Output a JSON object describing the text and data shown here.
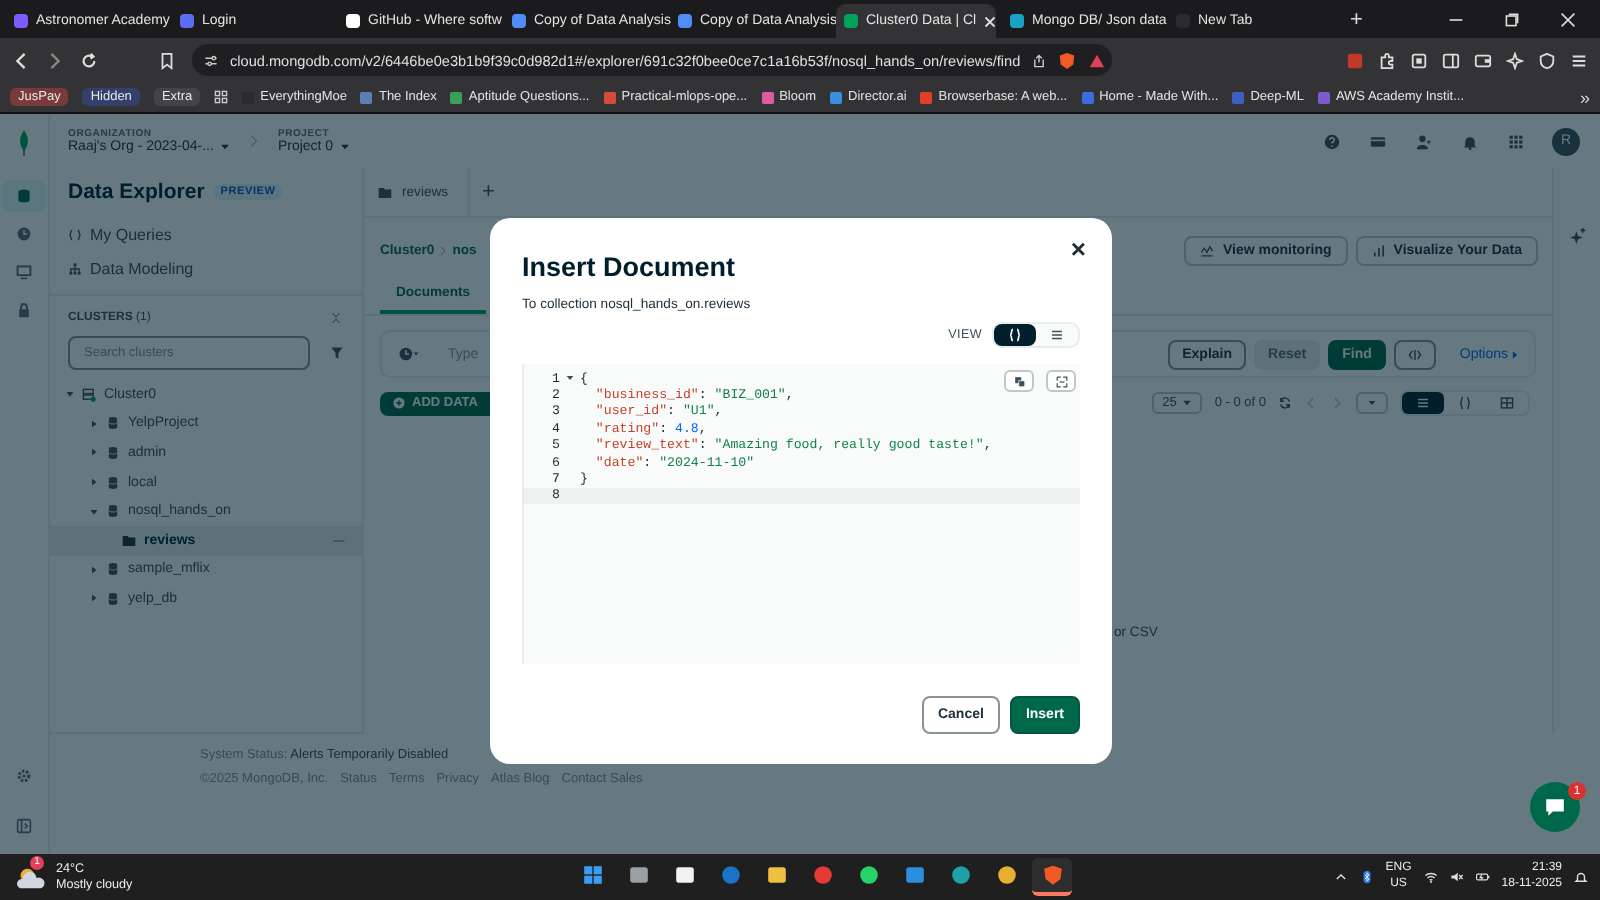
{
  "browser": {
    "tabs": [
      {
        "label": "Astronomer Academy",
        "color": "#7b5cff",
        "selected": false
      },
      {
        "label": "Login",
        "color": "#5b6cf0",
        "selected": false
      },
      {
        "label": "GitHub - Where softw",
        "color": "#ffffff",
        "selected": false
      },
      {
        "label": "Copy of Data Analysis",
        "color": "#4f8cf7",
        "selected": false
      },
      {
        "label": "Copy of Data Analysis",
        "color": "#4f8cf7",
        "selected": false
      },
      {
        "label": "Cluster0 Data | Cl",
        "color": "#00a35c",
        "selected": true
      },
      {
        "label": "Mongo DB/ Json data",
        "color": "#1ba3c6",
        "selected": false
      },
      {
        "label": "New Tab",
        "color": "#2b2b2d",
        "selected": false
      }
    ],
    "new_tab": "+",
    "url": "cloud.mongodb.com/v2/6446be0e3b1b9f39c0d982d1#/explorer/691c32f0bee0ce7c1a16b53f/nosql_hands_on/reviews/find",
    "bookmark_tags": [
      {
        "label": "JusPay",
        "color": "#7a3a3a"
      },
      {
        "label": "Hidden",
        "color": "#33406b"
      },
      {
        "label": "Extra",
        "color": "#444448"
      }
    ],
    "bookmarks": [
      {
        "label": "EverythingMoe",
        "color": "#2b2b2d"
      },
      {
        "label": "The Index",
        "color": "#5b7fb5"
      },
      {
        "label": "Aptitude Questions...",
        "color": "#3aa05a"
      },
      {
        "label": "Practical-mlops-ope...",
        "color": "#d84a3a"
      },
      {
        "label": "Bloom",
        "color": "#e05aa0"
      },
      {
        "label": "Director.ai",
        "color": "#3a8ee0"
      },
      {
        "label": "Browserbase: A web...",
        "color": "#e0402a"
      },
      {
        "label": "Home - Made With...",
        "color": "#3a6ee0"
      },
      {
        "label": "Deep-ML",
        "color": "#4060c0"
      },
      {
        "label": "AWS Academy Instit...",
        "color": "#7a5cd0"
      }
    ],
    "more": "»"
  },
  "rail": [
    {
      "kind": "database",
      "selected": true
    },
    {
      "kind": "clock",
      "selected": false
    },
    {
      "kind": "monitor",
      "selected": false
    },
    {
      "kind": "lock",
      "selected": false
    }
  ],
  "header": {
    "org_label": "ORGANIZATION",
    "org": "Raaj's Org - 2023-04-...",
    "project_label": "PROJECT",
    "project": "Project 0",
    "avatar": "R"
  },
  "sidebar": {
    "title": "Data Explorer",
    "badge": "PREVIEW",
    "links": [
      {
        "label": "My Queries",
        "kind": "queries"
      },
      {
        "label": "Data Modeling",
        "kind": "modeling"
      }
    ],
    "clusters_label": "CLUSTERS",
    "clusters_count": "(1)",
    "search_placeholder": "Search clusters",
    "tree": [
      {
        "label": "Cluster0",
        "kind": "cluster",
        "expanded": true,
        "children": [
          {
            "label": "YelpProject",
            "kind": "database",
            "expanded": false
          },
          {
            "label": "admin",
            "kind": "database",
            "expanded": false
          },
          {
            "label": "local",
            "kind": "database",
            "expanded": false
          },
          {
            "label": "nosql_hands_on",
            "kind": "database",
            "expanded": true,
            "children": [
              {
                "label": "reviews",
                "kind": "collection",
                "selected": true
              }
            ]
          },
          {
            "label": "sample_mflix",
            "kind": "database",
            "expanded": false
          },
          {
            "label": "yelp_db",
            "kind": "database",
            "expanded": false
          }
        ]
      }
    ]
  },
  "main": {
    "tab": "reviews",
    "add_tab": "+",
    "breadcrumb": [
      "Cluster0",
      "nos"
    ],
    "subtabs": [
      {
        "label": "Documents",
        "selected": true
      }
    ],
    "actions": [
      {
        "label": "View monitoring",
        "kind": "monitor"
      },
      {
        "label": "Visualize Your Data",
        "kind": "chart"
      }
    ],
    "filter_placeholder": "Type",
    "query_buttons": [
      {
        "label": "Explain",
        "kind": "default"
      },
      {
        "label": "Reset",
        "kind": "disabled"
      },
      {
        "label": "Find",
        "kind": "primary"
      }
    ],
    "options": "Options",
    "add_data": "ADD DATA",
    "page_size": "25",
    "range": "0 - 0 of 0",
    "views": [
      {
        "kind": "list",
        "selected": true
      },
      {
        "kind": "json",
        "selected": false
      },
      {
        "kind": "table",
        "selected": false
      }
    ],
    "empty_hint": "or CSV"
  },
  "footer": {
    "status_label": "System Status:",
    "status": "Alerts Temporarily Disabled",
    "links": [
      "©2025 MongoDB, Inc.",
      "Status",
      "Terms",
      "Privacy",
      "Atlas Blog",
      "Contact Sales"
    ]
  },
  "chat_badge": "1",
  "modal": {
    "title": "Insert Document",
    "subtitle": "To collection nosql_hands_on.reviews",
    "view_label": "VIEW",
    "views": [
      {
        "kind": "json",
        "selected": true
      },
      {
        "kind": "list",
        "selected": false
      }
    ],
    "lines": [
      {
        "num": "1",
        "fold": true,
        "active": false,
        "tokens": [
          {
            "kind": "punct",
            "text": "{"
          }
        ]
      },
      {
        "num": "2",
        "fold": false,
        "active": false,
        "tokens": [
          {
            "kind": "key",
            "text": "  \"business_id\""
          },
          {
            "kind": "punct",
            "text": ": "
          },
          {
            "kind": "string",
            "text": "\"BIZ_001\""
          },
          {
            "kind": "punct",
            "text": ","
          }
        ]
      },
      {
        "num": "3",
        "fold": false,
        "active": false,
        "tokens": [
          {
            "kind": "key",
            "text": "  \"user_id\""
          },
          {
            "kind": "punct",
            "text": ": "
          },
          {
            "kind": "string",
            "text": "\"U1\""
          },
          {
            "kind": "punct",
            "text": ","
          }
        ]
      },
      {
        "num": "4",
        "fold": false,
        "active": false,
        "tokens": [
          {
            "kind": "key",
            "text": "  \"rating\""
          },
          {
            "kind": "punct",
            "text": ": "
          },
          {
            "kind": "number",
            "text": "4.8"
          },
          {
            "kind": "punct",
            "text": ","
          }
        ]
      },
      {
        "num": "5",
        "fold": false,
        "active": false,
        "tokens": [
          {
            "kind": "key",
            "text": "  \"review_text\""
          },
          {
            "kind": "punct",
            "text": ": "
          },
          {
            "kind": "string",
            "text": "\"Amazing food, really good taste!\""
          },
          {
            "kind": "punct",
            "text": ","
          }
        ]
      },
      {
        "num": "6",
        "fold": false,
        "active": false,
        "tokens": [
          {
            "kind": "key",
            "text": "  \"date\""
          },
          {
            "kind": "punct",
            "text": ": "
          },
          {
            "kind": "string",
            "text": "\"2024-11-10\""
          }
        ]
      },
      {
        "num": "7",
        "fold": false,
        "active": false,
        "tokens": [
          {
            "kind": "punct",
            "text": "}"
          }
        ]
      },
      {
        "num": "8",
        "fold": false,
        "active": true
      }
    ],
    "close": "×",
    "buttons": [
      {
        "label": "Cancel",
        "kind": "secondary"
      },
      {
        "label": "Insert",
        "kind": "primary"
      }
    ]
  },
  "taskbar": {
    "weather_badge": "1",
    "temp": "24°C",
    "weather": "Mostly cloudy",
    "apps": [
      {
        "kind": "start",
        "selected": false
      },
      {
        "kind": "taskview",
        "selected": false
      },
      {
        "kind": "store",
        "selected": false
      },
      {
        "kind": "mail",
        "selected": false
      },
      {
        "kind": "files",
        "selected": false
      },
      {
        "kind": "video",
        "selected": false
      },
      {
        "kind": "chat",
        "selected": false
      },
      {
        "kind": "code",
        "selected": false
      },
      {
        "kind": "edge",
        "selected": false
      },
      {
        "kind": "chrome",
        "selected": false
      },
      {
        "kind": "brave",
        "selected": true
      }
    ],
    "lang": "ENG",
    "region": "US",
    "time": "21:39",
    "date": "18-11-2025"
  }
}
